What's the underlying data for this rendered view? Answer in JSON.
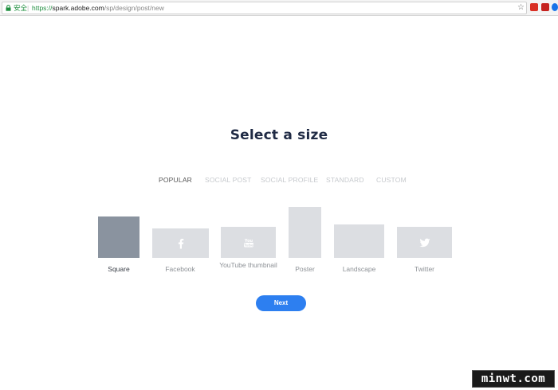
{
  "browser": {
    "secure_label": "安全",
    "separator": "|",
    "url_scheme": "https://",
    "url_host": "spark.adobe.com",
    "url_path": "/sp/design/post/new",
    "star_icon": "star-icon"
  },
  "page": {
    "title": "Select a size",
    "tabs": [
      {
        "label": "POPULAR",
        "active": true
      },
      {
        "label": "SOCIAL POST",
        "active": false
      },
      {
        "label": "SOCIAL PROFILE",
        "active": false
      },
      {
        "label": "STANDARD",
        "active": false
      },
      {
        "label": "CUSTOM",
        "active": false
      }
    ],
    "sizes": [
      {
        "label": "Square",
        "selected": true,
        "icon": ""
      },
      {
        "label": "Facebook",
        "selected": false,
        "icon": "facebook-icon"
      },
      {
        "label": "YouTube thumbnail",
        "selected": false,
        "icon": "youtube-icon"
      },
      {
        "label": "Poster",
        "selected": false,
        "icon": ""
      },
      {
        "label": "Landscape",
        "selected": false,
        "icon": ""
      },
      {
        "label": "Twitter",
        "selected": false,
        "icon": "twitter-icon"
      }
    ],
    "next_label": "Next"
  },
  "watermark": "minwt.com",
  "colors": {
    "accent": "#2d7ff0",
    "title": "#1f2a44",
    "card": "#dcdee2",
    "card_selected": "#8a939f"
  }
}
